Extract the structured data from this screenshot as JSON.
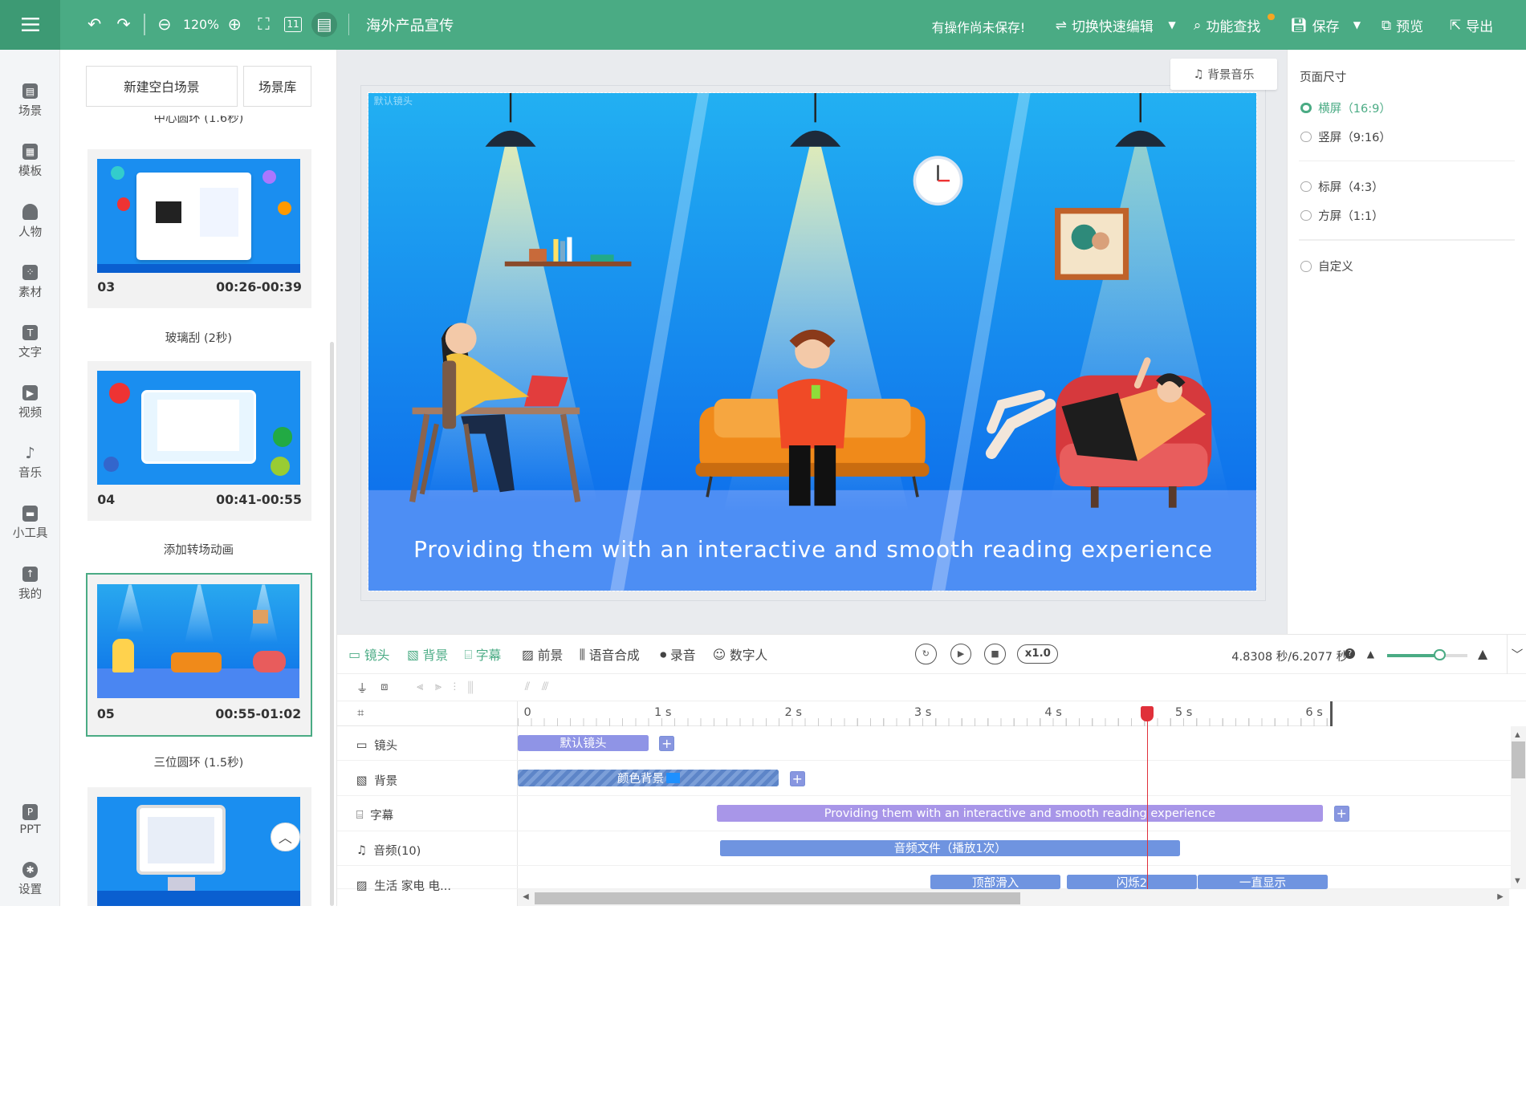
{
  "header": {
    "zoom": "120%",
    "project_title": "海外产品宣传",
    "unsaved_notice": "有操作尚未保存!",
    "switch_label": "切换快速编辑",
    "search_label": "功能查找",
    "save_label": "保存",
    "preview_label": "预览",
    "export_label": "导出",
    "ratio_icon_label": "11"
  },
  "leftnav": {
    "items": [
      {
        "label": "场景",
        "icon": "scene-icon"
      },
      {
        "label": "模板",
        "icon": "template-icon"
      },
      {
        "label": "人物",
        "icon": "person-icon"
      },
      {
        "label": "素材",
        "icon": "material-icon"
      },
      {
        "label": "文字",
        "icon": "text-icon"
      },
      {
        "label": "视频",
        "icon": "video-icon"
      },
      {
        "label": "音乐",
        "icon": "music-icon"
      },
      {
        "label": "小工具",
        "icon": "tools-icon"
      },
      {
        "label": "我的",
        "icon": "upload-icon"
      }
    ],
    "bottom": [
      {
        "label": "PPT",
        "icon": "ppt-icon"
      },
      {
        "label": "设置",
        "icon": "settings-icon"
      }
    ]
  },
  "scenes": {
    "new_blank": "新建空白场景",
    "library": "场景库",
    "transition_top": "中心圆环 (1.6秒)",
    "cards": [
      {
        "num": "03",
        "time": "00:26-00:39"
      },
      {
        "num": "04",
        "time": "00:41-00:55"
      },
      {
        "num": "05",
        "time": "00:55-01:02"
      }
    ],
    "transitions": [
      "玻璃刮 (2秒)",
      "添加转场动画",
      "三位圆环 (1.5秒)"
    ]
  },
  "canvas": {
    "bg_music": "背景音乐",
    "lens_label": "默认镜头",
    "subtitle": "Providing them with an interactive and smooth reading experience"
  },
  "page_size": {
    "title": "页面尺寸",
    "options": [
      {
        "label": "横屏（16:9）",
        "selected": true
      },
      {
        "label": "竖屏（9:16）",
        "selected": false
      },
      {
        "label": "标屏（4:3）",
        "selected": false
      },
      {
        "label": "方屏（1:1）",
        "selected": false
      },
      {
        "label": "自定义",
        "selected": false
      }
    ]
  },
  "timeline": {
    "tabs": [
      "镜头",
      "背景",
      "字幕",
      "前景",
      "语音合成",
      "录音",
      "数字人"
    ],
    "speed": "x1.0",
    "time_readout": "4.8308 秒/6.2077 秒",
    "ticks": [
      "0",
      "1 s",
      "2 s",
      "3 s",
      "4 s",
      "5 s",
      "6 s"
    ],
    "tracks": [
      {
        "label": "镜头",
        "icon": "camera-icon"
      },
      {
        "label": "背景",
        "icon": "background-icon"
      },
      {
        "label": "字幕",
        "icon": "subtitle-icon"
      },
      {
        "label": "音频(10)",
        "icon": "audio-icon"
      },
      {
        "label": "生活 家电 电...",
        "icon": "image-icon"
      }
    ],
    "clips": {
      "lens": "默认镜头",
      "background": "颜色背景",
      "subtitle": "Providing them with an interactive and smooth reading experience",
      "audio": "音频文件（播放1次）",
      "anim1": "顶部滑入",
      "anim2": "闪烁2",
      "anim3": "一直显示"
    },
    "playhead_seconds": 4.8308,
    "total_seconds": 6.2077
  },
  "colors": {
    "brand": "#4aab84",
    "clip_purple": "#9b8ee6",
    "clip_blue": "#6f94e0",
    "stage_blue": "#1c7ff0"
  }
}
